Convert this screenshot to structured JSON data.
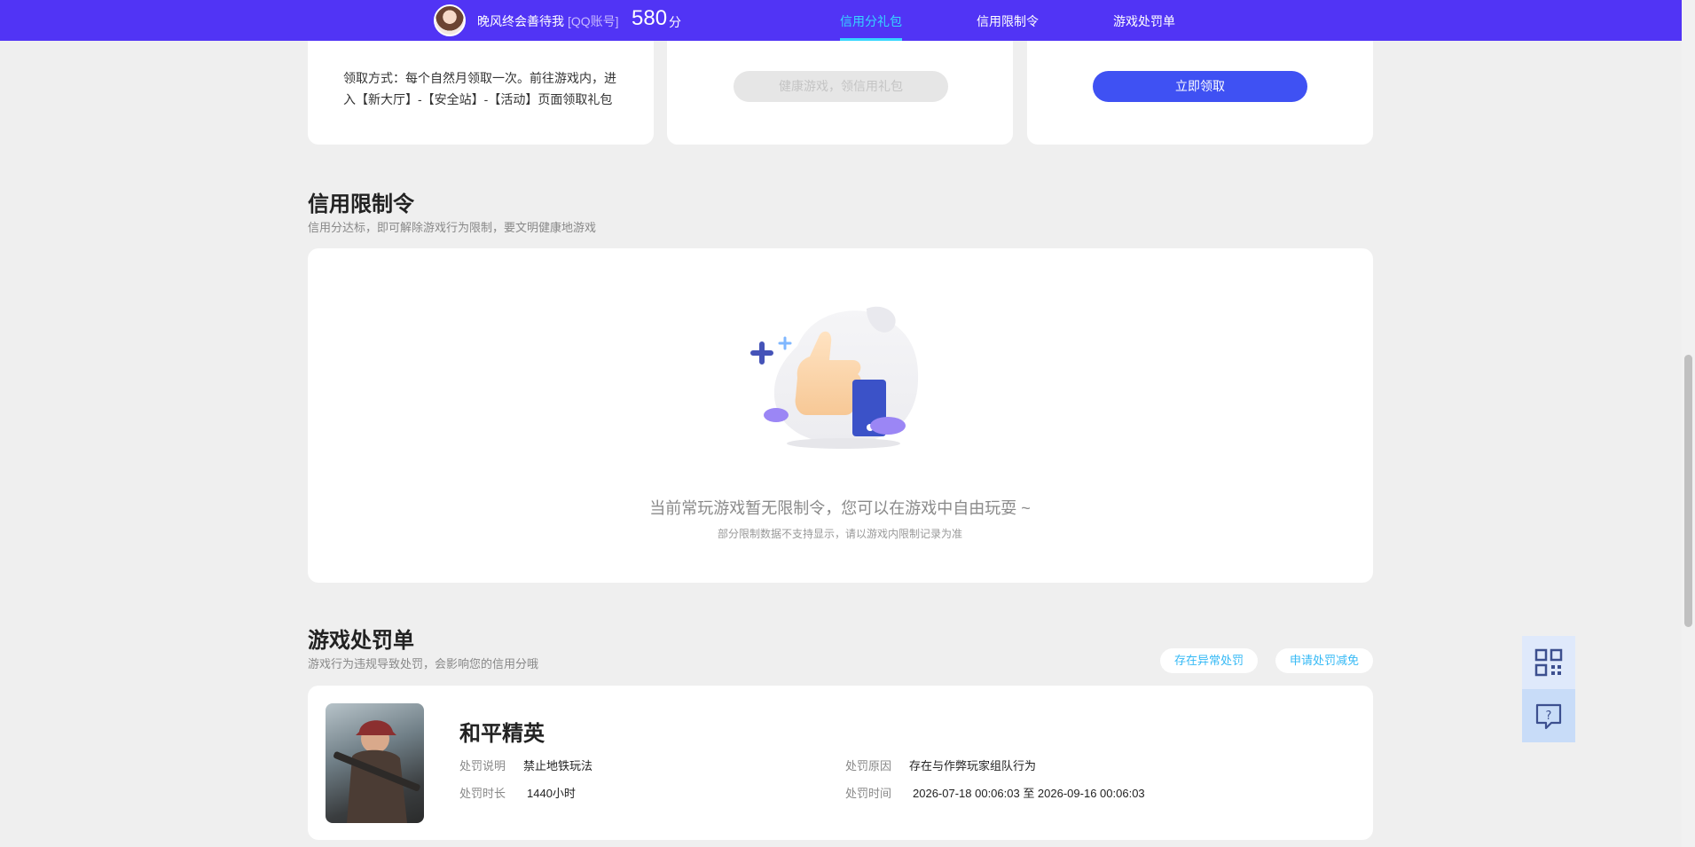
{
  "header": {
    "user_name": "晚风终会善待我",
    "account_type": "[QQ账号]",
    "score": "580",
    "score_unit": "分",
    "tabs": [
      {
        "label": "信用分礼包",
        "active": true
      },
      {
        "label": "信用限制令",
        "active": false
      },
      {
        "label": "游戏处罚单",
        "active": false
      }
    ],
    "accent_color": "#5134f5",
    "active_tab_color": "#35d7ff"
  },
  "gift_cards": {
    "method_text": "领取方式：每个自然月领取一次。前往游戏内，进入【新大厅】-【安全站】-【活动】页面领取礼包",
    "disabled_button": "健康游戏，领信用礼包",
    "claim_button": "立即领取"
  },
  "restriction": {
    "title": "信用限制令",
    "subtitle": "信用分达标，即可解除游戏行为限制，要文明健康地游戏",
    "empty_title": "当前常玩游戏暂无限制令，您可以在游戏中自由玩耍 ~",
    "empty_note": "部分限制数据不支持显示，请以游戏内限制记录为准",
    "illustration": "thumbs-up-illustration"
  },
  "penalty": {
    "title": "游戏处罚单",
    "subtitle": "游戏行为违规导致处罚，会影响您的信用分哦",
    "chips": [
      "存在异常处罚",
      "申请处罚减免"
    ],
    "record": {
      "game_name": "和平精英",
      "desc_label": "处罚说明",
      "desc_value": "禁止地铁玩法",
      "reason_label": "处罚原因",
      "reason_value": "存在与作弊玩家组队行为",
      "duration_label": "处罚时长",
      "duration_value": "1440小时",
      "time_label": "处罚时间",
      "time_value": "2026-07-18 00:06:03 至 2026-09-16 00:06:03"
    }
  },
  "float_panel": {
    "icons": [
      "qrcode-icon",
      "help-chat-icon"
    ]
  }
}
